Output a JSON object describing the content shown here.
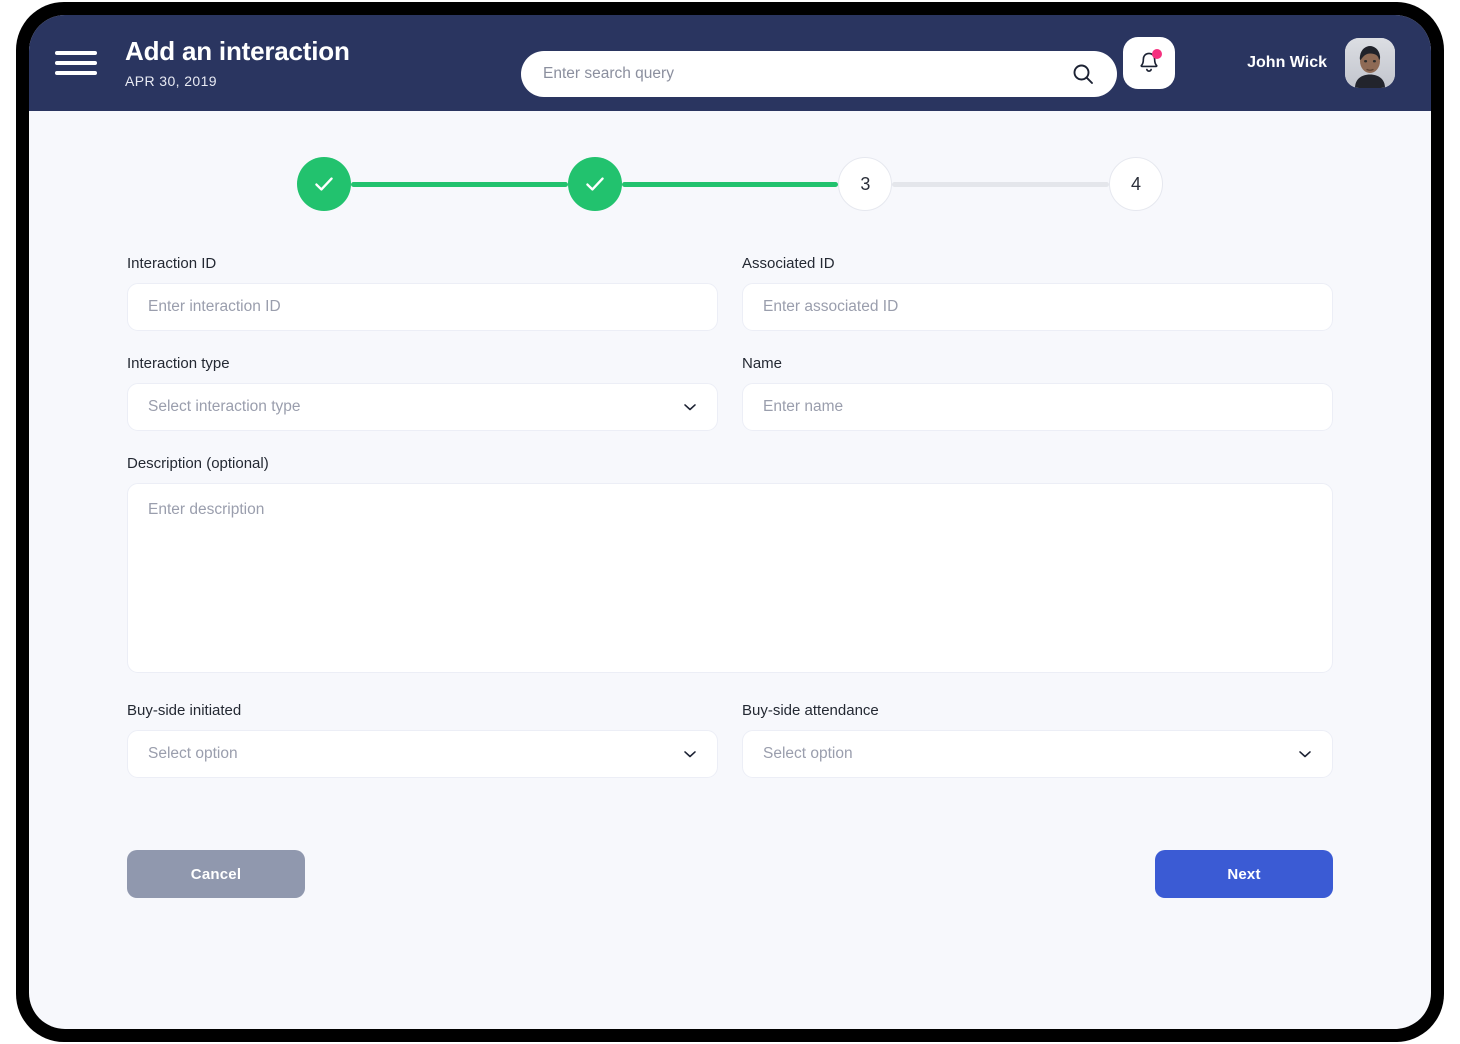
{
  "header": {
    "menu_icon": "hamburger-menu-icon",
    "title": "Add an interaction",
    "date": "APR 30, 2019",
    "search": {
      "placeholder": "Enter search query",
      "value": "",
      "icon": "search-icon"
    },
    "notifications": {
      "icon": "bell-icon",
      "has_unread": true,
      "badge_color": "#f5317f"
    },
    "user": {
      "name": "John Wick",
      "avatar": "user-avatar"
    },
    "background_color": "#2a3560"
  },
  "stepper": {
    "steps": [
      {
        "label": "1",
        "state": "done",
        "display": "check"
      },
      {
        "label": "2",
        "state": "done",
        "display": "check"
      },
      {
        "label": "3",
        "state": "current",
        "display": "3"
      },
      {
        "label": "4",
        "state": "pending",
        "display": "4"
      }
    ],
    "connectors": [
      "active",
      "active",
      "inactive"
    ],
    "done_color": "#22c26e",
    "inactive_color": "#e4e6eb"
  },
  "form": {
    "interaction_id": {
      "label": "Interaction ID",
      "placeholder": "Enter interaction ID",
      "value": ""
    },
    "associated_id": {
      "label": "Associated ID",
      "placeholder": "Enter associated ID",
      "value": ""
    },
    "interaction_type": {
      "label": "Interaction type",
      "placeholder": "Select interaction type",
      "value": "Select interaction type"
    },
    "name": {
      "label": "Name",
      "placeholder": "Enter name",
      "value": ""
    },
    "description": {
      "label": "Description (optional)",
      "placeholder": "Enter description",
      "value": ""
    },
    "buy_side_initiated": {
      "label": "Buy-side initiated",
      "placeholder": "Select option",
      "value": "Select option"
    },
    "buy_side_attendance": {
      "label": "Buy-side attendance",
      "placeholder": "Select option",
      "value": "Select option"
    }
  },
  "actions": {
    "cancel_label": "Cancel",
    "next_label": "Next",
    "cancel_color": "#9098ae",
    "next_color": "#3b5bd4"
  },
  "page": {
    "background_color": "#f7f8fc"
  }
}
